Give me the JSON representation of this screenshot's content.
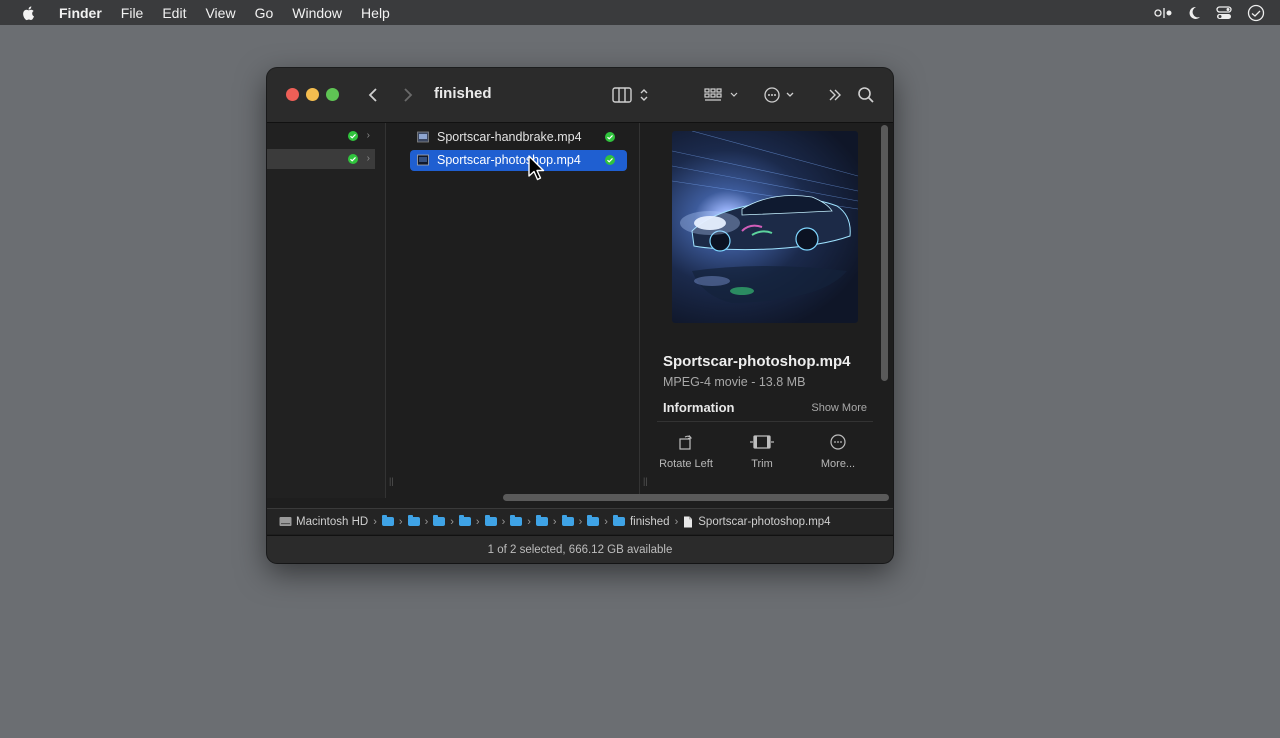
{
  "menubar": {
    "app": "Finder",
    "items": [
      "File",
      "Edit",
      "View",
      "Go",
      "Window",
      "Help"
    ]
  },
  "window": {
    "title": "finished",
    "files": [
      {
        "name": "Sportscar-handbrake.mp4",
        "selected": false,
        "status": "synced"
      },
      {
        "name": "Sportscar-photoshop.mp4",
        "selected": true,
        "status": "synced"
      }
    ],
    "preview": {
      "name": "Sportscar-photoshop.mp4",
      "type": "MPEG-4 movie - 13.8 MB",
      "info_label": "Information",
      "show_more": "Show More",
      "actions": [
        "Rotate Left",
        "Trim",
        "More..."
      ]
    },
    "pathbar": {
      "root": "Macintosh HD",
      "current_folder": "finished",
      "file": "Sportscar-photoshop.mp4"
    },
    "status": "1 of 2 selected, 666.12 GB available"
  },
  "colors": {
    "selection": "#1f5fd1",
    "check": "#30c43d",
    "folder": "#3fa3e6"
  }
}
